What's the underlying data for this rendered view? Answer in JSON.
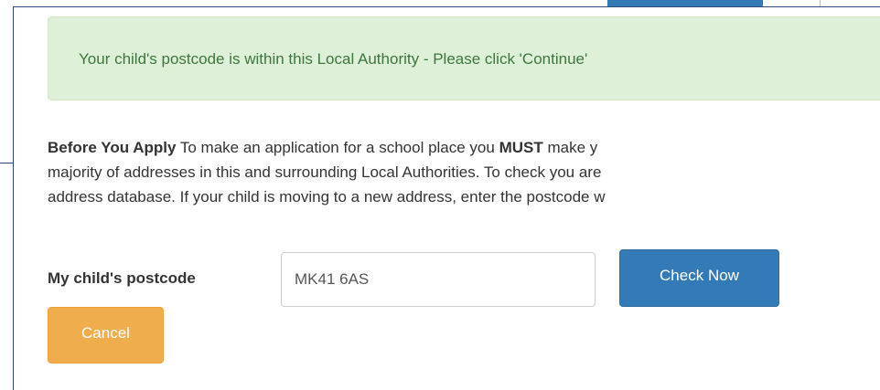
{
  "alert": {
    "message": "Your child's postcode is within this Local Authority - Please click 'Continue'"
  },
  "intro": {
    "line1_bold_a": "Before You Apply",
    "line1_text_a": " To make an application for a school place you ",
    "line1_bold_b": "MUST",
    "line1_text_b": " make y",
    "line2": "majority of addresses in this and surrounding Local Authorities. To check you are",
    "line3": "address database. If your child is moving to a new address, enter the postcode w"
  },
  "form": {
    "postcode_label": "My child's postcode",
    "postcode_value": "MK41 6AS",
    "check_button": "Check Now",
    "cancel_button": "Cancel"
  },
  "colors": {
    "alert_bg": "#dff0d8",
    "alert_text": "#3c763d",
    "primary": "#337ab7",
    "warning": "#f0ad4e",
    "frame_border": "#2e4a7a"
  }
}
